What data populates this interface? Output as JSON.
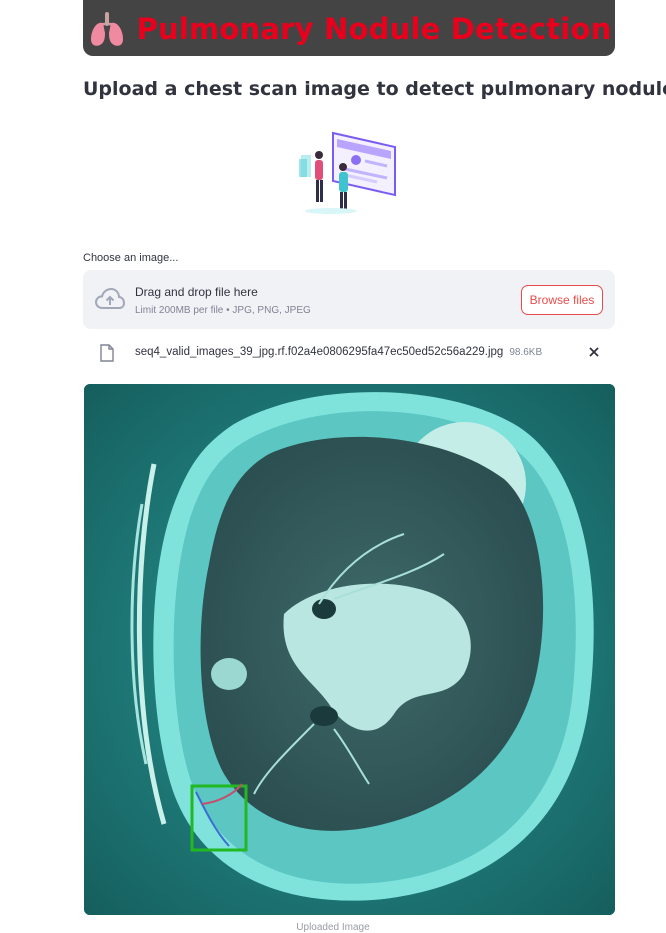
{
  "header": {
    "emoji_icon": "lungs-icon",
    "title": "Pulmonary Nodule Detection",
    "title_color": "#e8001c",
    "banner_color": "#444444"
  },
  "subtitle": "Upload a chest scan image to detect pulmonary nodules.",
  "illustration_icon": "doctors-screen-illustration",
  "uploader": {
    "label": "Choose an image...",
    "drop_text": "Drag and drop file here",
    "limit_text": "Limit 200MB per file • JPG, PNG, JPEG",
    "browse_label": "Browse files",
    "accent_color": "#e94b4b"
  },
  "uploaded_file": {
    "name": "seq4_valid_images_39_jpg.rf.f02a4e0806295fa47ec50ed52c56a229.jpg",
    "size": "98.6KB"
  },
  "image": {
    "caption": "Uploaded Image",
    "detection_box_color": "#22b822"
  }
}
